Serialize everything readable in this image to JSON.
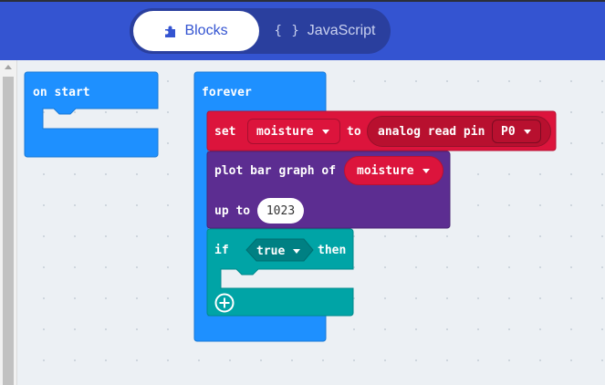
{
  "tabs": {
    "blocks": "Blocks",
    "javascript": "JavaScript",
    "js_braces": "{ }"
  },
  "blocks": {
    "on_start": "on start",
    "forever": "forever",
    "set": "set",
    "variable": "moisture",
    "to": "to",
    "analog_read_pin": "analog read pin",
    "pin": "P0",
    "plot_bar_graph_of": "plot bar graph of",
    "plot_variable": "moisture",
    "up_to": "up to",
    "up_to_value": "1023",
    "if": "if",
    "condition": "true",
    "then": "then"
  },
  "colors": {
    "header": "#3454d1",
    "events": "#1e90ff",
    "variables": "#dc143c",
    "pins": "#b8102f",
    "led": "#5c2d91",
    "logic": "#00a4a6"
  },
  "icons": {
    "blocks_tab": "puzzle-piece-icon",
    "add": "plus-circle-icon"
  }
}
